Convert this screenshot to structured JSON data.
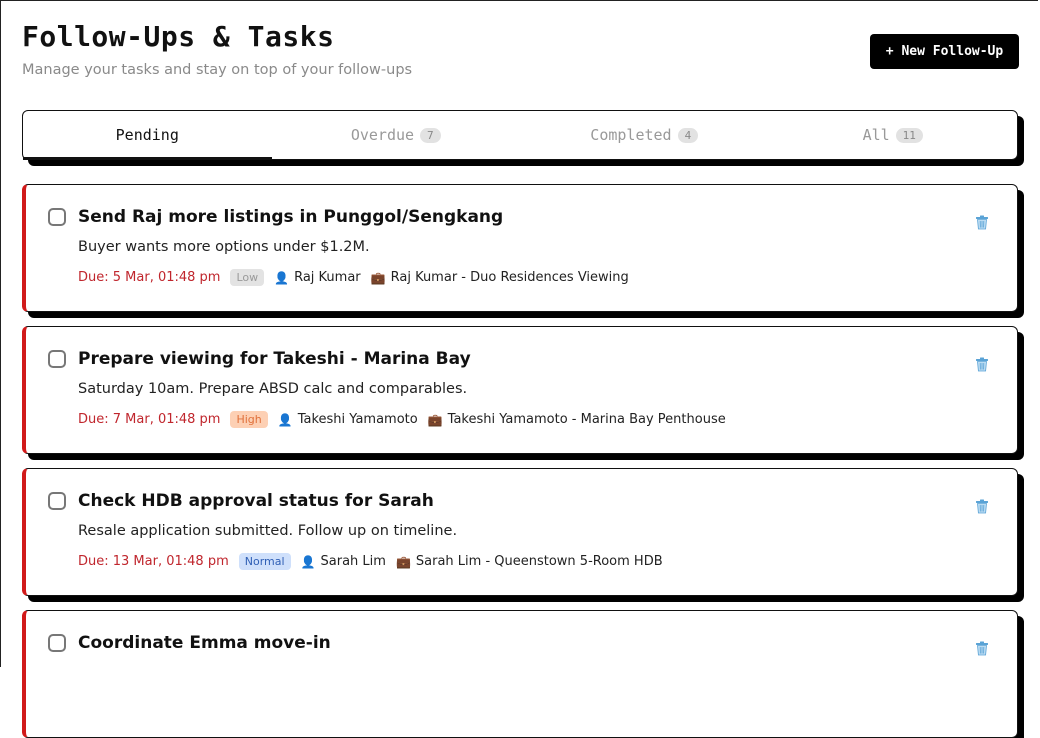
{
  "header": {
    "title": "Follow-Ups & Tasks",
    "subtitle": "Manage your tasks and stay on top of your follow-ups",
    "new_button": "+ New Follow-Up"
  },
  "tabs": [
    {
      "label": "Pending",
      "count": null,
      "active": true
    },
    {
      "label": "Overdue",
      "count": "7",
      "active": false
    },
    {
      "label": "Completed",
      "count": "4",
      "active": false
    },
    {
      "label": "All",
      "count": "11",
      "active": false
    }
  ],
  "tasks": [
    {
      "title": "Send Raj more listings in Punggol/Sengkang",
      "description": "Buyer wants more options under $1.2M.",
      "due": "Due: 5 Mar, 01:48 pm",
      "priority": "Low",
      "contact": "Raj Kumar",
      "deal": "Raj Kumar - Duo Residences Viewing"
    },
    {
      "title": "Prepare viewing for Takeshi - Marina Bay",
      "description": "Saturday 10am. Prepare ABSD calc and comparables.",
      "due": "Due: 7 Mar, 01:48 pm",
      "priority": "High",
      "contact": "Takeshi Yamamoto",
      "deal": "Takeshi Yamamoto - Marina Bay Penthouse"
    },
    {
      "title": "Check HDB approval status for Sarah",
      "description": "Resale application submitted. Follow up on timeline.",
      "due": "Due: 13 Mar, 01:48 pm",
      "priority": "Normal",
      "contact": "Sarah Lim",
      "deal": "Sarah Lim - Queenstown 5-Room HDB"
    },
    {
      "title": "Coordinate Emma move-in",
      "description": "",
      "due": "",
      "priority": "",
      "contact": "",
      "deal": ""
    }
  ],
  "icons": {
    "person": "person-icon",
    "briefcase": "briefcase-icon",
    "trash": "trash-icon"
  },
  "colors": {
    "accent": "#000000",
    "overdue_border": "#d11a1a",
    "due_text": "#c0262d"
  }
}
